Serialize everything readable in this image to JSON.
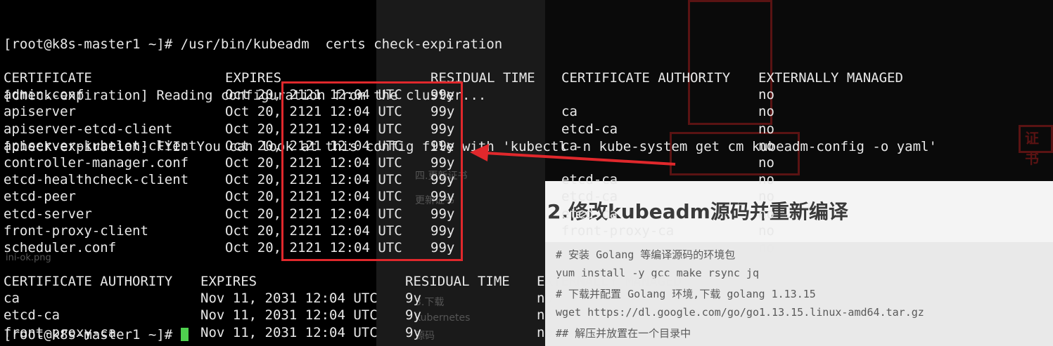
{
  "prompt_line": "[root@k8s-master1 ~]# /usr/bin/kubeadm  certs check-expiration",
  "info_lines": [
    "[check-expiration] Reading configuration from the cluster...",
    "[check-expiration] FYI: You can look at this config file with 'kubectl -n kube-system get cm kubeadm-config -o yaml'"
  ],
  "cert_table": {
    "headers": [
      "CERTIFICATE",
      "EXPIRES",
      "RESIDUAL TIME",
      "CERTIFICATE AUTHORITY",
      "EXTERNALLY MANAGED"
    ],
    "rows": [
      {
        "name": "admin.conf",
        "expires": "Oct 20, 2121 12:04 UTC",
        "residual": "99y",
        "ca": "",
        "ext": "no"
      },
      {
        "name": "apiserver",
        "expires": "Oct 20, 2121 12:04 UTC",
        "residual": "99y",
        "ca": "ca",
        "ext": "no"
      },
      {
        "name": "apiserver-etcd-client",
        "expires": "Oct 20, 2121 12:04 UTC",
        "residual": "99y",
        "ca": "etcd-ca",
        "ext": "no"
      },
      {
        "name": "apiserver-kubelet-client",
        "expires": "Oct 20, 2121 12:04 UTC",
        "residual": "99y",
        "ca": "ca",
        "ext": "no"
      },
      {
        "name": "controller-manager.conf",
        "expires": "Oct 20, 2121 12:04 UTC",
        "residual": "99y",
        "ca": "",
        "ext": "no"
      },
      {
        "name": "etcd-healthcheck-client",
        "expires": "Oct 20, 2121 12:04 UTC",
        "residual": "99y",
        "ca": "etcd-ca",
        "ext": "no"
      },
      {
        "name": "etcd-peer",
        "expires": "Oct 20, 2121 12:04 UTC",
        "residual": "99y",
        "ca": "etcd-ca",
        "ext": "no"
      },
      {
        "name": "etcd-server",
        "expires": "Oct 20, 2121 12:04 UTC",
        "residual": "99y",
        "ca": "etcd-ca",
        "ext": "no"
      },
      {
        "name": "front-proxy-client",
        "expires": "Oct 20, 2121 12:04 UTC",
        "residual": "99y",
        "ca": "front-proxy-ca",
        "ext": "no"
      },
      {
        "name": "scheduler.conf",
        "expires": "Oct 20, 2121 12:04 UTC",
        "residual": "99y",
        "ca": "",
        "ext": "no"
      }
    ]
  },
  "ca_table": {
    "headers": [
      "CERTIFICATE AUTHORITY",
      "EXPIRES",
      "RESIDUAL TIME",
      "EXTERNALLY MANAGED"
    ],
    "rows": [
      {
        "name": "ca",
        "expires": "Nov 11, 2031 12:04 UTC",
        "residual": "9y",
        "ext": "no"
      },
      {
        "name": "etcd-ca",
        "expires": "Nov 11, 2031 12:04 UTC",
        "residual": "9y",
        "ext": "no"
      },
      {
        "name": "front-proxy-ca",
        "expires": "Nov 11, 2031 12:04 UTC",
        "residual": "9y",
        "ext": "no"
      }
    ]
  },
  "next_prompt": "[root@k8s-master1 ~]# ",
  "background": {
    "heading": "2.修改kubeadm源码并重新编译",
    "code_lines": [
      "# 安装 Golang 等编译源码的环境包",
      "yum install -y gcc make rsync jq",
      "# 下载并配置 Golang 环境,下载 golang 1.13.15",
      "wget https://dl.google.com/go/go1.13.15.linux-amd64.tar.gz",
      "## 解压并放置在一个目录中"
    ],
    "side_items": [
      "四.更新证书",
      "更新证书",
      "3.下载",
      "kubernetes",
      "源码"
    ],
    "image_label": "ini-ok.png",
    "badge_text": "证书"
  },
  "colors": {
    "terminal_bg": "#000000",
    "terminal_fg": "#e8e8e8",
    "highlight": "#e0282c",
    "cursor": "#4fd14f"
  }
}
